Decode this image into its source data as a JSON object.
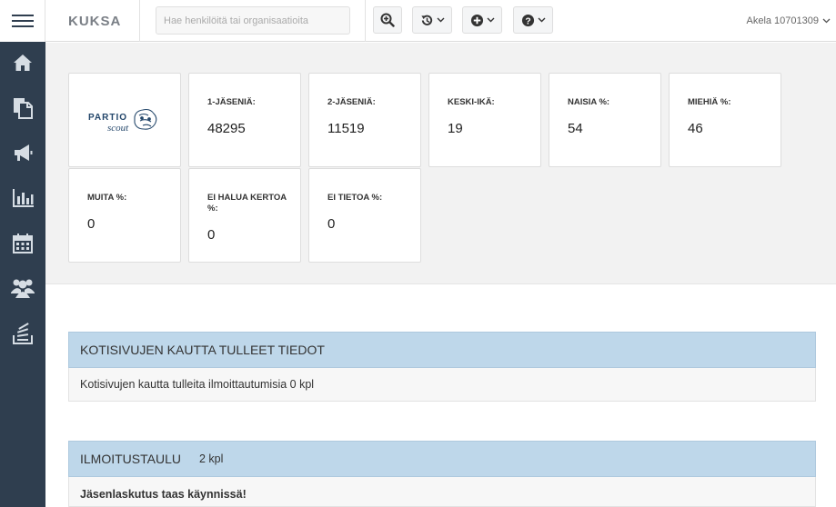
{
  "header": {
    "brand": "KUKSA",
    "search_placeholder": "Hae henkilöitä tai organisaatioita",
    "user": "Akela 10701309"
  },
  "toolbar": {
    "icons": [
      "zoom-in-icon",
      "history-icon",
      "plus-circle-icon",
      "help-icon"
    ]
  },
  "sidebar": {
    "items": [
      "home-icon",
      "documents-icon",
      "megaphone-icon",
      "bar-chart-icon",
      "calendar-icon",
      "users-icon",
      "reports-icon"
    ]
  },
  "logo": {
    "line1": "PARTIO",
    "line2": "scout"
  },
  "stats": [
    {
      "label": "1-JÄSENIÄ:",
      "value": "48295"
    },
    {
      "label": "2-JÄSENIÄ:",
      "value": "11519"
    },
    {
      "label": "KESKI-IKÄ:",
      "value": "19"
    },
    {
      "label": "NAISIA %:",
      "value": "54"
    },
    {
      "label": "MIEHIÄ %:",
      "value": "46"
    },
    {
      "label": "MUITA %:",
      "value": "0"
    },
    {
      "label": "EI HALUA KERTOA %:",
      "value": "0"
    },
    {
      "label": "EI TIETOA %:",
      "value": "0"
    }
  ],
  "panels": {
    "homepage": {
      "title": "KOTISIVUJEN KAUTTA TULLEET TIEDOT",
      "body": "Kotisivujen kautta tulleita ilmoittautumisia 0 kpl"
    },
    "board": {
      "title": "ILMOITUSTAULU",
      "count": "2 kpl",
      "first_item": "Jäsenlaskutus taas käynnissä!"
    }
  },
  "colors": {
    "sidebar": "#2f3e4f",
    "panel_header": "#bed7ea"
  }
}
